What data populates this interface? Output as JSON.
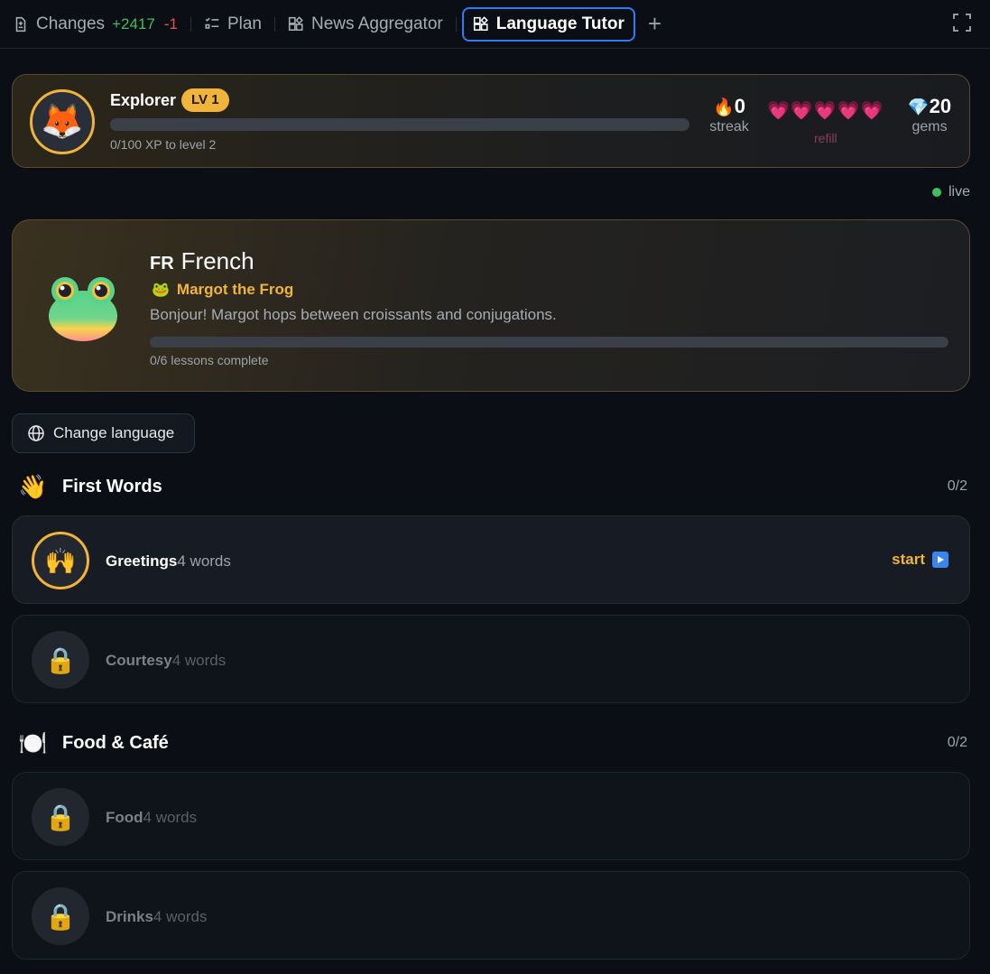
{
  "tabs": {
    "changes": {
      "label": "Changes",
      "added": "+2417",
      "removed": "-1"
    },
    "plan": {
      "label": "Plan"
    },
    "news": {
      "label": "News Aggregator"
    },
    "active": {
      "label": "Language Tutor"
    },
    "add_label": "+"
  },
  "profile": {
    "avatar_icon": "🦊",
    "name": "Explorer",
    "level_badge": "LV 1",
    "xp_progress": 0,
    "xp_text": "0/100 XP to level 2",
    "streak_icon": "🔥",
    "streak_value": "0",
    "streak_label": "streak",
    "hearts": "💗💗💗💗💗",
    "hearts_count": 5,
    "refill_label": "refill",
    "gems_icon": "💎",
    "gems_value": "20",
    "gems_label": "gems"
  },
  "status": {
    "live_label": "live",
    "live_color": "#3fbf5f"
  },
  "language": {
    "code": "FR",
    "name": "French",
    "tutor_icon": "🐸",
    "tutor_name": "Margot the Frog",
    "description": "Bonjour! Margot hops between croissants and conjugations.",
    "progress": 0,
    "progress_text": "0/6 lessons complete"
  },
  "change_language_label": "Change language",
  "sections": [
    {
      "icon": "👋",
      "title": "First Words",
      "count": "0/2",
      "lessons": [
        {
          "icon": "🙌",
          "title": "Greetings",
          "count": "4 words",
          "state": "active",
          "action": "start"
        },
        {
          "icon": "🔒",
          "title": "Courtesy",
          "count": "4 words",
          "state": "locked"
        }
      ]
    },
    {
      "icon": "🍽️",
      "title": "Food & Café",
      "count": "0/2",
      "lessons": [
        {
          "icon": "🔒",
          "title": "Food",
          "count": "4 words",
          "state": "locked"
        },
        {
          "icon": "🔒",
          "title": "Drinks",
          "count": "4 words",
          "state": "locked"
        }
      ]
    }
  ],
  "colors": {
    "accent": "#f0b43a",
    "tab_active_border": "#2f7bf2",
    "background": "#0b0e14"
  }
}
